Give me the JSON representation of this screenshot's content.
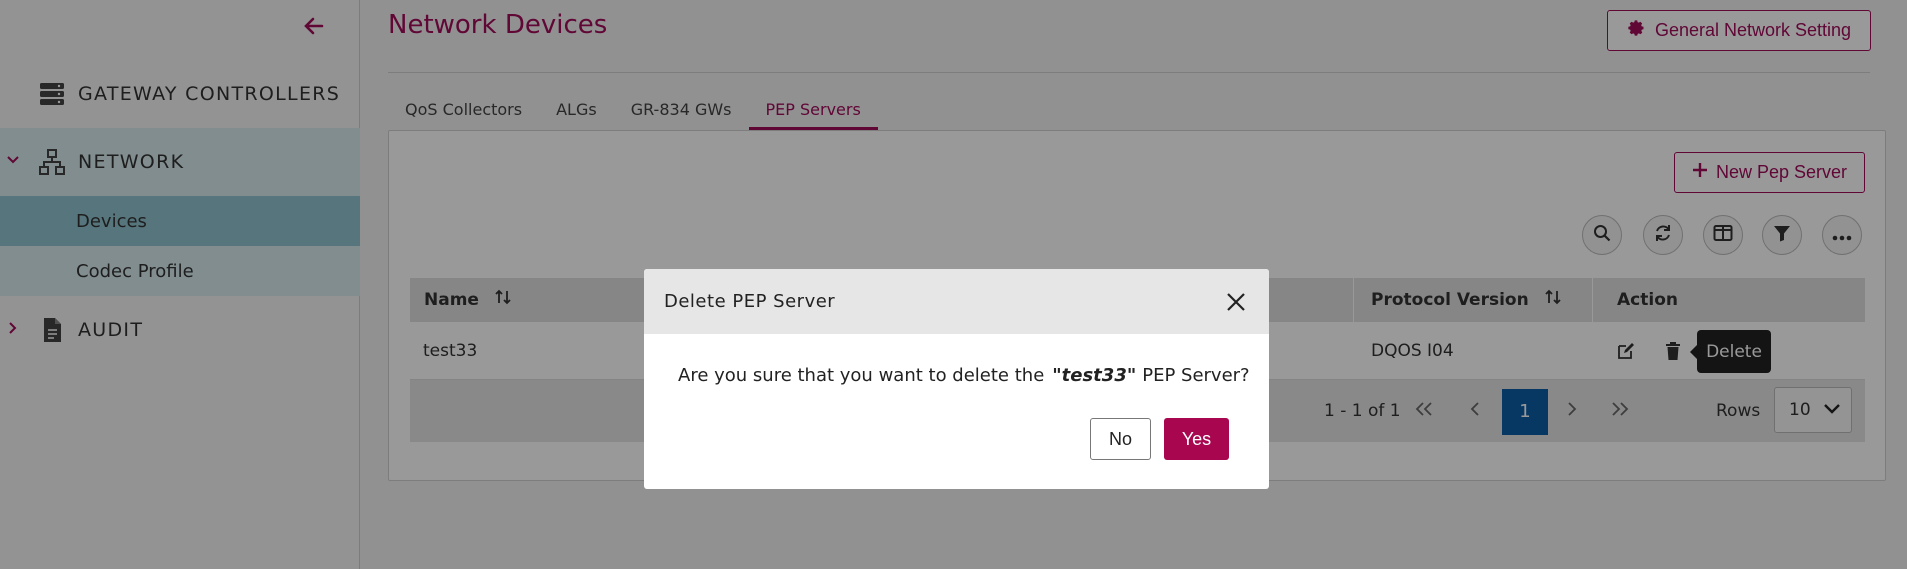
{
  "sidebar": {
    "back_icon": "arrow-left-icon",
    "items": [
      {
        "label": "GATEWAY CONTROLLERS",
        "icon": "server-icon"
      },
      {
        "label": "NETWORK",
        "icon": "network-icon",
        "expanded": true,
        "children": [
          {
            "label": "Devices",
            "active": true
          },
          {
            "label": "Codec Profile"
          }
        ]
      },
      {
        "label": "AUDIT",
        "icon": "document-icon",
        "expanded": false
      }
    ]
  },
  "header": {
    "title": "Network Devices",
    "general_setting_label": "General Network Setting"
  },
  "tabs": [
    {
      "label": "QoS Collectors"
    },
    {
      "label": "ALGs"
    },
    {
      "label": "GR-834 GWs"
    },
    {
      "label": "PEP Servers",
      "active": true
    }
  ],
  "toolbar": {
    "new_label": "New Pep Server",
    "icons": [
      "search-icon",
      "refresh-icon",
      "columns-icon",
      "filter-icon",
      "more-icon"
    ]
  },
  "table": {
    "columns": [
      {
        "label": "Name"
      },
      {
        "label": "Protocol Version"
      },
      {
        "label": "Action"
      }
    ],
    "rows": [
      {
        "name": "test33",
        "protocol_version": "DQOS I04"
      }
    ],
    "tooltip": "Delete"
  },
  "pagination": {
    "info": "1 - 1 of 1",
    "current_page": "1",
    "rows_label": "Rows",
    "rows_value": "10"
  },
  "dialog": {
    "title": "Delete PEP Server",
    "message_before": "Are you sure that you want to delete the",
    "message_target": "\"test33\"",
    "message_after": "PEP Server?",
    "no_label": "No",
    "yes_label": "Yes"
  },
  "colors": {
    "accent": "#a00d5b",
    "primary_blue": "#0a5ea6",
    "active_nav": "#90c4cf"
  }
}
